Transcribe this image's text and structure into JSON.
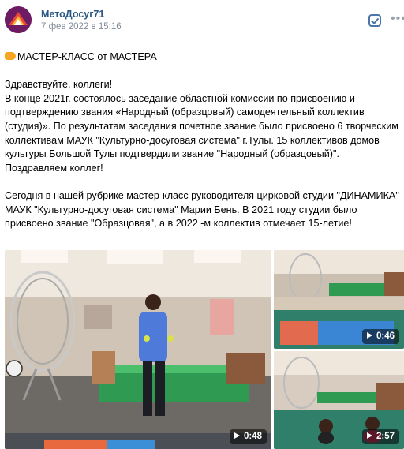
{
  "post": {
    "author": "МетоДосуг71",
    "date": "7 фев 2022 в 15:16",
    "title": "МАСТЕР-КЛАСС от МАСТЕРА",
    "paragraph1": [
      "Здравствуйте, коллеги!",
      "В конце 2021г. состоялось заседание областной комиссии по присвоению и",
      "подтверждению звания «Народный (образцовый) самодеятельный коллектив",
      "(студия)». По результатам заседания почетное звание было присвоено 6 творческим",
      "коллективам МАУК \"Культурно-досуговая система\" г.Тулы. 15 коллективов домов",
      "культуры Большой Тулы подтвердили звание \"Народный (образцовый)\".",
      "Поздравляем коллег!"
    ],
    "paragraph2": [
      "Сегодня в нашей рубрике мастер-класс руководителя цирковой студии \"ДИНАМИКА\"",
      "МАУК \"Культурно-досуговая система\" Марии Бень. В 2021 году студии было",
      "присвоено звание \"Образцовая\", а в 2022 -м коллектив отмечает 15-летие!"
    ]
  },
  "icons": {
    "avatar": "community-logo-icon",
    "bookmark": "checkbox-icon",
    "more": "more-dots-icon",
    "title_emoji": "pointing-hand-icon",
    "play": "play-icon"
  },
  "videos": [
    {
      "duration": "0:48"
    },
    {
      "duration": "0:46"
    },
    {
      "duration": "2:57"
    }
  ],
  "colors": {
    "author": "#2a5885",
    "date": "#818c99",
    "accent": "#4a76a8"
  }
}
